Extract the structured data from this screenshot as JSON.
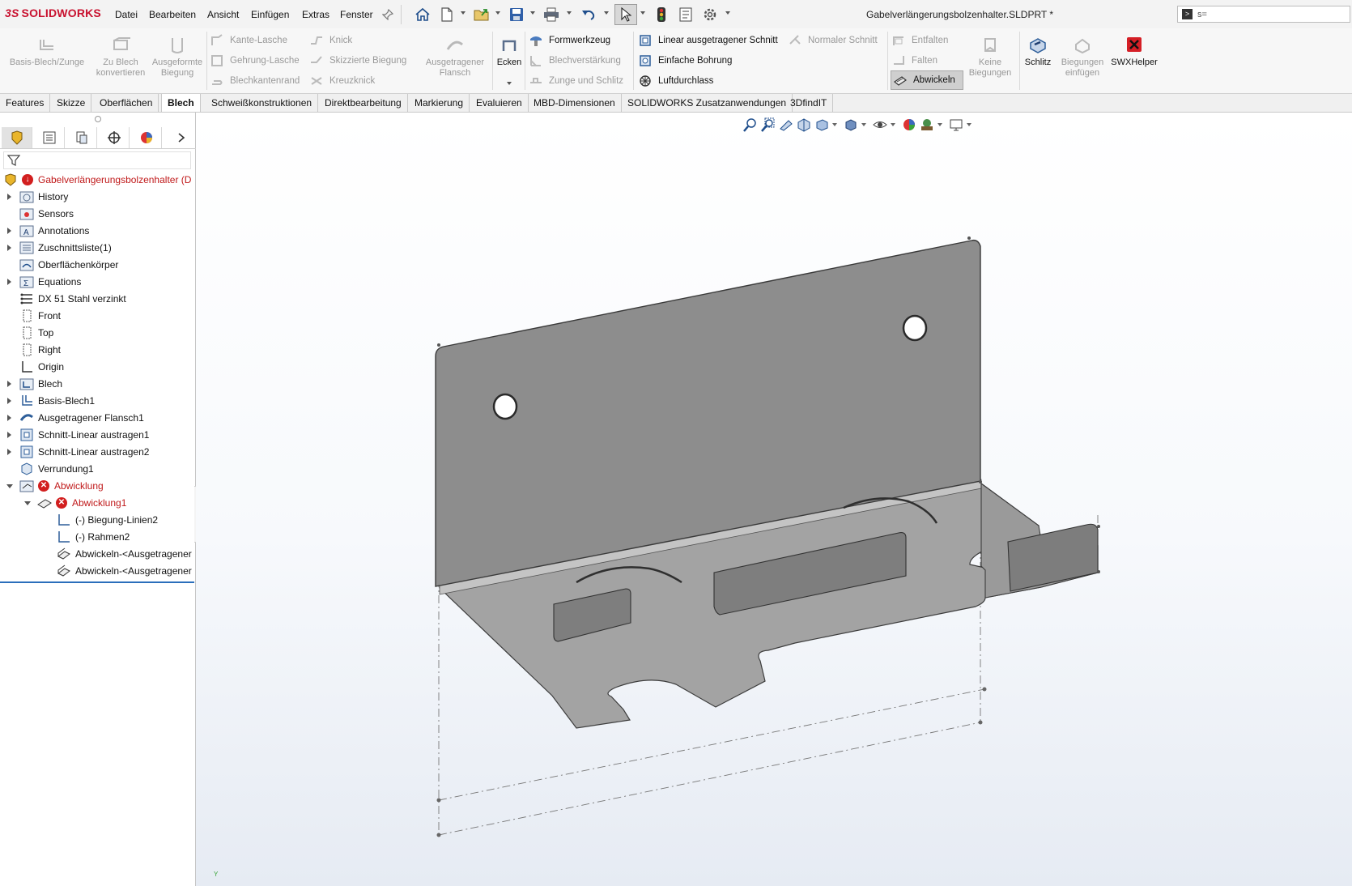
{
  "app": {
    "brand_prefix": "3S",
    "brand_name": "SOLIDWORKS",
    "document_title": "Gabelverlängerungsbolzenhalter.SLDPRT *"
  },
  "menu": [
    "Datei",
    "Bearbeiten",
    "Ansicht",
    "Einfügen",
    "Extras",
    "Fenster"
  ],
  "search": {
    "value": "s="
  },
  "ribbon": {
    "basis_blech": "Basis-Blech/Zunge",
    "zu_blech": [
      "Zu Blech",
      "konvertieren"
    ],
    "ausgeformte": [
      "Ausgeformte",
      "Biegung"
    ],
    "kante_lasche": "Kante-Lasche",
    "gehrung_lasche": "Gehrung-Lasche",
    "blechkantenrand": "Blechkantenrand",
    "knick": "Knick",
    "skizzierte_biegung": "Skizzierte Biegung",
    "kreuzknick": "Kreuzknick",
    "ausgetragener_flansch": [
      "Ausgetragener",
      "Flansch"
    ],
    "ecken": "Ecken",
    "formwerkzeug": "Formwerkzeug",
    "blechverstaerkung": "Blechverstärkung",
    "zunge_schlitz": "Zunge und Schlitz",
    "linear_schnitt": "Linear ausgetragener Schnitt",
    "einfache_bohrung": "Einfache Bohrung",
    "luftdurchlass": "Luftdurchlass",
    "normaler_schnitt": "Normaler Schnitt",
    "entfalten": "Entfalten",
    "falten": "Falten",
    "abwickeln": "Abwickeln",
    "keine_biegungen": [
      "Keine",
      "Biegungen"
    ],
    "schlitz": "Schlitz",
    "biegungen_einfuegen": [
      "Biegungen",
      "einfügen"
    ],
    "swxhelper": "SWXHelper"
  },
  "tabs": [
    "Features",
    "Skizze",
    "Oberflächen",
    "Blech",
    "Schweißkonstruktionen",
    "Direktbearbeitung",
    "Markierung",
    "Evaluieren",
    "MBD-Dimensionen",
    "SOLIDWORKS Zusatzanwendungen",
    "3DfindIT"
  ],
  "active_tab": "Blech",
  "tree": {
    "root": "Gabelverlängerungsbolzenhalter (D",
    "items": [
      "History",
      "Sensors",
      "Annotations",
      "Zuschnittsliste(1)",
      "Oberflächenkörper",
      "Equations",
      "DX 51 Stahl verzinkt",
      "Front",
      "Top",
      "Right",
      "Origin",
      "Blech",
      "Basis-Blech1",
      "Ausgetragener Flansch1",
      "Schnitt-Linear austragen1",
      "Schnitt-Linear austragen2",
      "Verrundung1",
      "Abwicklung",
      "Abwicklung1",
      "(-) Biegung-Linien2",
      "(-) Rahmen2",
      "Abwickeln-<Ausgetragener",
      "Abwickeln-<Ausgetragener"
    ]
  },
  "viewport": {
    "axis_label": "Y"
  },
  "colors": {
    "error": "#c0191a",
    "brand": "#c8102e",
    "part": "#8c8c8c",
    "selection": "#2a6ebb"
  }
}
